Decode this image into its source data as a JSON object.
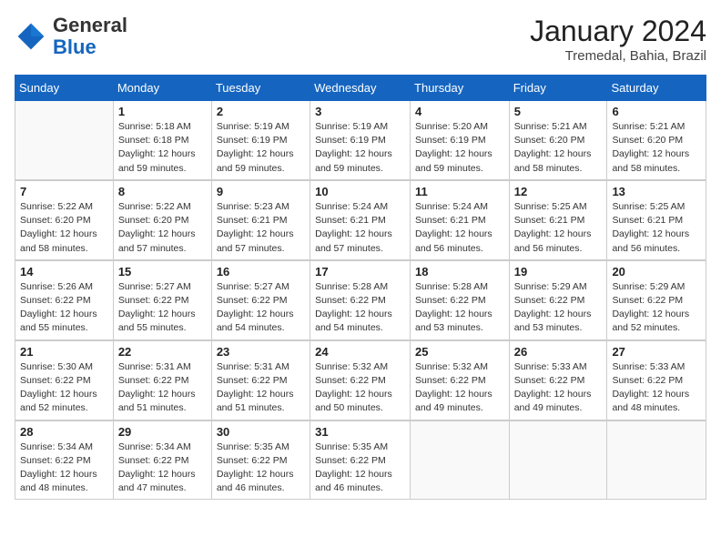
{
  "logo": {
    "general": "General",
    "blue": "Blue"
  },
  "header": {
    "month": "January 2024",
    "location": "Tremedal, Bahia, Brazil"
  },
  "columns": [
    "Sunday",
    "Monday",
    "Tuesday",
    "Wednesday",
    "Thursday",
    "Friday",
    "Saturday"
  ],
  "weeks": [
    [
      {
        "day": null
      },
      {
        "day": "1",
        "sunrise": "5:18 AM",
        "sunset": "6:18 PM",
        "daylight": "12 hours and 59 minutes."
      },
      {
        "day": "2",
        "sunrise": "5:19 AM",
        "sunset": "6:19 PM",
        "daylight": "12 hours and 59 minutes."
      },
      {
        "day": "3",
        "sunrise": "5:19 AM",
        "sunset": "6:19 PM",
        "daylight": "12 hours and 59 minutes."
      },
      {
        "day": "4",
        "sunrise": "5:20 AM",
        "sunset": "6:19 PM",
        "daylight": "12 hours and 59 minutes."
      },
      {
        "day": "5",
        "sunrise": "5:21 AM",
        "sunset": "6:20 PM",
        "daylight": "12 hours and 58 minutes."
      },
      {
        "day": "6",
        "sunrise": "5:21 AM",
        "sunset": "6:20 PM",
        "daylight": "12 hours and 58 minutes."
      }
    ],
    [
      {
        "day": "7",
        "sunrise": "5:22 AM",
        "sunset": "6:20 PM",
        "daylight": "12 hours and 58 minutes."
      },
      {
        "day": "8",
        "sunrise": "5:22 AM",
        "sunset": "6:20 PM",
        "daylight": "12 hours and 57 minutes."
      },
      {
        "day": "9",
        "sunrise": "5:23 AM",
        "sunset": "6:21 PM",
        "daylight": "12 hours and 57 minutes."
      },
      {
        "day": "10",
        "sunrise": "5:24 AM",
        "sunset": "6:21 PM",
        "daylight": "12 hours and 57 minutes."
      },
      {
        "day": "11",
        "sunrise": "5:24 AM",
        "sunset": "6:21 PM",
        "daylight": "12 hours and 56 minutes."
      },
      {
        "day": "12",
        "sunrise": "5:25 AM",
        "sunset": "6:21 PM",
        "daylight": "12 hours and 56 minutes."
      },
      {
        "day": "13",
        "sunrise": "5:25 AM",
        "sunset": "6:21 PM",
        "daylight": "12 hours and 56 minutes."
      }
    ],
    [
      {
        "day": "14",
        "sunrise": "5:26 AM",
        "sunset": "6:22 PM",
        "daylight": "12 hours and 55 minutes."
      },
      {
        "day": "15",
        "sunrise": "5:27 AM",
        "sunset": "6:22 PM",
        "daylight": "12 hours and 55 minutes."
      },
      {
        "day": "16",
        "sunrise": "5:27 AM",
        "sunset": "6:22 PM",
        "daylight": "12 hours and 54 minutes."
      },
      {
        "day": "17",
        "sunrise": "5:28 AM",
        "sunset": "6:22 PM",
        "daylight": "12 hours and 54 minutes."
      },
      {
        "day": "18",
        "sunrise": "5:28 AM",
        "sunset": "6:22 PM",
        "daylight": "12 hours and 53 minutes."
      },
      {
        "day": "19",
        "sunrise": "5:29 AM",
        "sunset": "6:22 PM",
        "daylight": "12 hours and 53 minutes."
      },
      {
        "day": "20",
        "sunrise": "5:29 AM",
        "sunset": "6:22 PM",
        "daylight": "12 hours and 52 minutes."
      }
    ],
    [
      {
        "day": "21",
        "sunrise": "5:30 AM",
        "sunset": "6:22 PM",
        "daylight": "12 hours and 52 minutes."
      },
      {
        "day": "22",
        "sunrise": "5:31 AM",
        "sunset": "6:22 PM",
        "daylight": "12 hours and 51 minutes."
      },
      {
        "day": "23",
        "sunrise": "5:31 AM",
        "sunset": "6:22 PM",
        "daylight": "12 hours and 51 minutes."
      },
      {
        "day": "24",
        "sunrise": "5:32 AM",
        "sunset": "6:22 PM",
        "daylight": "12 hours and 50 minutes."
      },
      {
        "day": "25",
        "sunrise": "5:32 AM",
        "sunset": "6:22 PM",
        "daylight": "12 hours and 49 minutes."
      },
      {
        "day": "26",
        "sunrise": "5:33 AM",
        "sunset": "6:22 PM",
        "daylight": "12 hours and 49 minutes."
      },
      {
        "day": "27",
        "sunrise": "5:33 AM",
        "sunset": "6:22 PM",
        "daylight": "12 hours and 48 minutes."
      }
    ],
    [
      {
        "day": "28",
        "sunrise": "5:34 AM",
        "sunset": "6:22 PM",
        "daylight": "12 hours and 48 minutes."
      },
      {
        "day": "29",
        "sunrise": "5:34 AM",
        "sunset": "6:22 PM",
        "daylight": "12 hours and 47 minutes."
      },
      {
        "day": "30",
        "sunrise": "5:35 AM",
        "sunset": "6:22 PM",
        "daylight": "12 hours and 46 minutes."
      },
      {
        "day": "31",
        "sunrise": "5:35 AM",
        "sunset": "6:22 PM",
        "daylight": "12 hours and 46 minutes."
      },
      {
        "day": null
      },
      {
        "day": null
      },
      {
        "day": null
      }
    ]
  ],
  "labels": {
    "sunrise_prefix": "Sunrise: ",
    "sunset_prefix": "Sunset: ",
    "daylight_prefix": "Daylight: "
  }
}
